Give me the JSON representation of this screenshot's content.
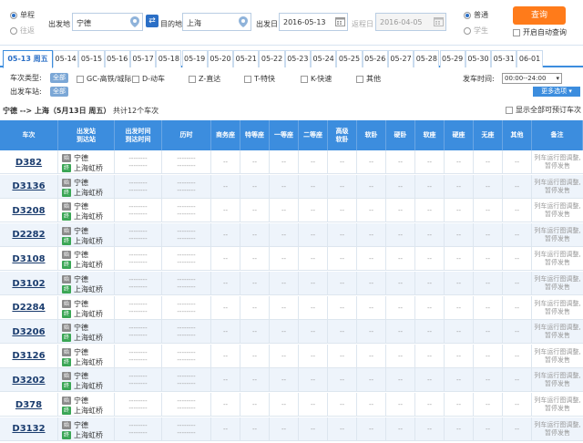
{
  "search": {
    "trip_types": [
      "单程",
      "往返"
    ],
    "from_label": "出发地",
    "from_value": "宁德",
    "to_label": "目的地",
    "to_value": "上海",
    "date_label": "出发日",
    "date_value": "2016-05-13",
    "return_label": "返程日",
    "return_value": "2016-04-05",
    "passenger_types": [
      "普通",
      "学生"
    ],
    "query_label": "查询",
    "auto_query_label": "开启自动查询"
  },
  "dates": [
    "05-13 周五",
    "05-14",
    "05-15",
    "05-16",
    "05-17",
    "05-18",
    "05-19",
    "05-20",
    "05-21",
    "05-22",
    "05-23",
    "05-24",
    "05-25",
    "05-26",
    "05-27",
    "05-28",
    "05-29",
    "05-30",
    "05-31",
    "06-01"
  ],
  "filters": {
    "train_type_label": "车次类型:",
    "station_label": "出发车站:",
    "all_label": "全部",
    "options": [
      "GC-高铁/城际",
      "D-动车",
      "Z-直达",
      "T-特快",
      "K-快速",
      "其他"
    ],
    "depart_time_label": "发车时间:",
    "depart_time_value": "00:00--24:00",
    "more_label": "更多选项"
  },
  "summary": {
    "route": "宁德 --> 上海（5月13日 周五）",
    "count": "共计12个车次",
    "show_all_label": "显示全部可预订车次"
  },
  "table": {
    "headers": [
      "车次",
      "出发站\n到达站",
      "出发时间\n到达时间",
      "历时",
      "商务座",
      "特等座",
      "一等座",
      "二等座",
      "高级\n软卧",
      "软卧",
      "硬卧",
      "软座",
      "硬座",
      "无座",
      "其他",
      "备注"
    ],
    "from_station": "宁德",
    "to_station": "上海虹桥",
    "from_icon": "始",
    "to_icon": "终",
    "placeholder": "--",
    "time_placeholder": "--------",
    "note": "列车运行图调整,暂停发售",
    "trains": [
      "D382",
      "D3136",
      "D3208",
      "D2282",
      "D3108",
      "D3102",
      "D2284",
      "D3206",
      "D3126",
      "D3202",
      "D378",
      "D3132"
    ]
  }
}
